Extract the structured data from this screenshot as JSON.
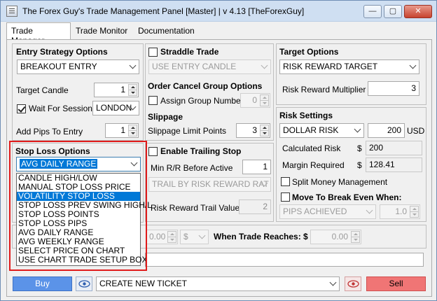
{
  "window": {
    "title": "The Forex Guy's Trade Management Panel [Master] | v 4.13 [TheForexGuy]",
    "minimize": "—",
    "maximize": "▢",
    "close": "✕"
  },
  "tabs": [
    "Trade Manager",
    "Trade Monitor",
    "Documentation"
  ],
  "entry": {
    "title": "Entry Strategy Options",
    "strategy": "BREAKOUT ENTRY",
    "target_candle_label": "Target Candle",
    "target_candle_value": "1",
    "wait_label": "Wait For Session",
    "session_value": "LONDON",
    "add_pips_label": "Add Pips To Entry",
    "add_pips_value": "1"
  },
  "straddle": {
    "title": "Straddle Trade",
    "candle_value": "USE ENTRY CANDLE",
    "order_cancel_title": "Order Cancel Group Options",
    "assign_group_label": "Assign Group Number",
    "assign_group_value": "0",
    "slippage_title": "Slippage",
    "slippage_label": "Slippage Limit Points",
    "slippage_value": "3"
  },
  "target": {
    "title": "Target Options",
    "type": "RISK REWARD TARGET",
    "multiplier_label": "Risk Reward Multiplier",
    "multiplier_value": "3"
  },
  "risk": {
    "title": "Risk Settings",
    "type": "DOLLAR RISK",
    "amount": "200",
    "currency": "USD",
    "calculated_label": "Calculated Risk",
    "calculated_currency": "$",
    "calculated_value": "200",
    "margin_label": "Margin Required",
    "margin_currency": "$",
    "margin_value": "128.41",
    "split_label": "Split Money Management",
    "breakeven_label": "Move To Break Even When:",
    "breakeven_type": "PIPS ACHIEVED",
    "breakeven_value": "1.0"
  },
  "stoploss": {
    "title": "Stop Loss Options",
    "selected": "AVG DAILY RANGE",
    "options": [
      "CANDLE HIGH/LOW",
      "MANUAL STOP LOSS PRICE",
      "VOLATILITY STOP LOSS",
      "STOP LOSS PREV SWING HIGH/L",
      "STOP LOSS POINTS",
      "STOP LOSS PIPS",
      "AVG DAILY RANGE",
      "AVG WEEKLY RANGE",
      "SELECT PRICE ON CHART",
      "USE CHART TRADE SETUP BOX"
    ],
    "highlighted_index": 2
  },
  "trailing": {
    "title": "Enable Trailing Stop",
    "min_rr_label": "Min R/R Before Active",
    "min_rr_value": "1",
    "type": "TRAIL BY RISK REWARD RAT",
    "rr_trail_label": "Risk Reward Trail Value",
    "rr_trail_value": "2"
  },
  "partial": {
    "value1": "0.00",
    "unit": "$",
    "trade_reaches_label": "When Trade Reaches: $",
    "trade_reaches_value": "0.00"
  },
  "bottom": {
    "buy_label": "Buy",
    "ticket": "CREATE NEW TICKET",
    "sell_label": "Sell"
  },
  "colors": {
    "buy": "#5b93e8",
    "sell": "#f07575",
    "highlight": "#0078d7",
    "callout": "#e01b1b"
  }
}
